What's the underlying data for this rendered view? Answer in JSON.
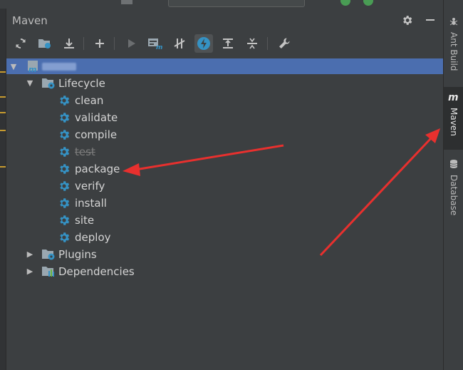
{
  "panel": {
    "title": "Maven"
  },
  "toolbar": {
    "buttons": [
      {
        "name": "reimport-all-icon"
      },
      {
        "name": "generate-sources-icon"
      },
      {
        "name": "download-sources-icon"
      },
      {
        "name": "add-project-icon"
      },
      {
        "name": "run-icon"
      },
      {
        "name": "execute-goal-icon"
      },
      {
        "name": "toggle-offline-icon"
      },
      {
        "name": "skip-tests-icon",
        "active": true
      },
      {
        "name": "show-dependencies-icon"
      },
      {
        "name": "collapse-all-icon"
      },
      {
        "name": "settings-wrench-icon"
      }
    ]
  },
  "tree": {
    "lifecycle": {
      "label": "Lifecycle",
      "phases": [
        {
          "label": "clean"
        },
        {
          "label": "validate"
        },
        {
          "label": "compile"
        },
        {
          "label": "test",
          "struck": true
        },
        {
          "label": "package"
        },
        {
          "label": "verify"
        },
        {
          "label": "install"
        },
        {
          "label": "site"
        },
        {
          "label": "deploy"
        }
      ]
    },
    "plugins": {
      "label": "Plugins"
    },
    "dependencies": {
      "label": "Dependencies"
    }
  },
  "sidebar": {
    "tabs": [
      {
        "label": "Ant Build",
        "icon": "ant-icon"
      },
      {
        "label": "Maven",
        "icon": "maven-icon",
        "active": true
      },
      {
        "label": "Database",
        "icon": "database-icon"
      }
    ]
  },
  "colors": {
    "background": "#3c3f41",
    "selection": "#4b6eaf",
    "gear": "#3592c4",
    "annotation_arrow": "#e8302e"
  }
}
